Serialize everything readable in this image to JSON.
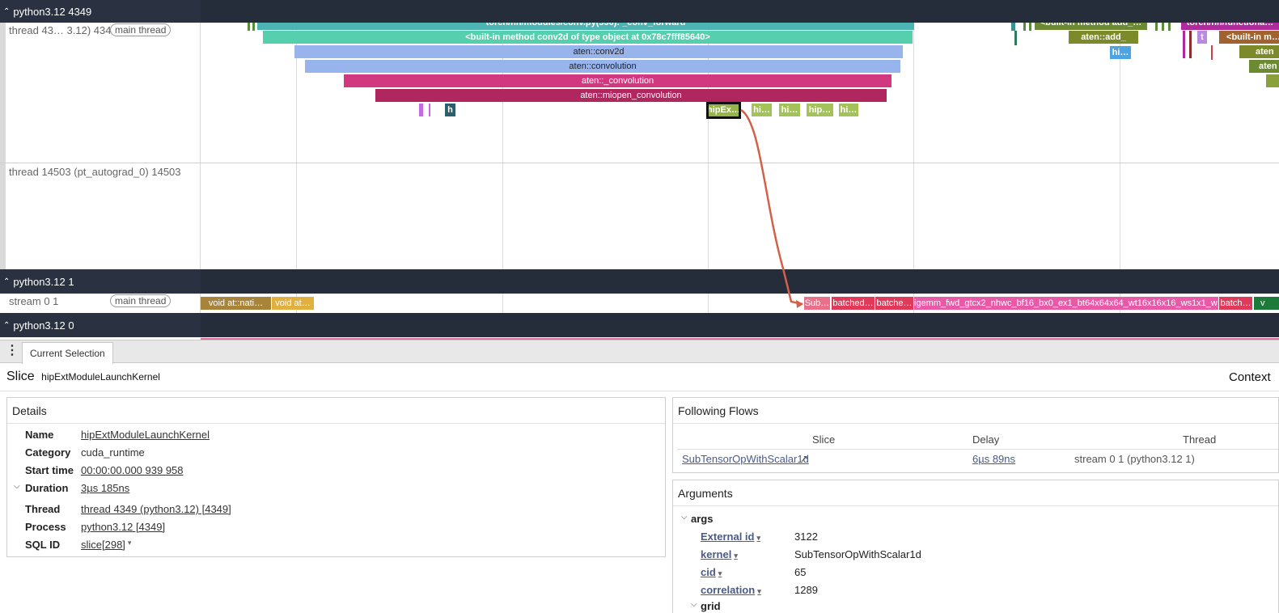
{
  "processes": {
    "p4349": {
      "title": "python3.12 4349"
    },
    "p1": {
      "title": "python3.12 1"
    },
    "p0": {
      "title": "python3.12 0"
    }
  },
  "tracks": {
    "main_thread": {
      "name": "thread 43…  3.12) 4349",
      "tag": "main thread"
    },
    "autograd": {
      "name": "thread 14503 (pt_autograd_0) 14503"
    },
    "stream": {
      "name": "stream 0 1",
      "tag": "main thread"
    }
  },
  "slices": {
    "conv_forward": "torch/nn/modules/conv.py(536): _conv_forward",
    "builtin_conv2d": "<built-in method conv2d of type object at 0x78c7fff85640>",
    "aten_conv2d": "aten::conv2d",
    "aten_convolution": "aten::convolution",
    "aten_underscore_convolution": "aten::_convolution",
    "aten_miopen": "aten::miopen_convolution",
    "h": "h",
    "hipext": "hipEx…",
    "hi1": "hi…",
    "hi2": "hi…",
    "hip3": "hip…",
    "hi4": "hi…",
    "builtin_add": "<built-in method add_…",
    "aten_add": "aten::add_",
    "hi_right": "hi…",
    "torch_functional": "torch/nn/functiona…",
    "t": "t",
    "builtin_right": "<built-in m…",
    "ater1": "aten",
    "ater2": "aten",
    "void1": "void at::nati…",
    "void2": "void at…",
    "sub": "Sub…",
    "batched1": "batched…",
    "batched2": "batche…",
    "igemm": "igemm_fwd_gtcx2_nhwc_bf16_bx0_ex1_bt64x64x64_wt16x16x16_ws1x1_w…",
    "batch3": "batch…",
    "v": "v"
  },
  "panel": {
    "tab": "Current Selection",
    "slice_label": "Slice",
    "slice_name": "hipExtModuleLaunchKernel",
    "context": "Context"
  },
  "details": {
    "title": "Details",
    "name_k": "Name",
    "name_v": "hipExtModuleLaunchKernel",
    "category_k": "Category",
    "category_v": "cuda_runtime",
    "start_k": "Start time",
    "start_v": "00:00:00.000 939 958",
    "duration_k": "Duration",
    "duration_v": "3µs 185ns",
    "thread_k": "Thread",
    "thread_v": "thread 4349 (python3.12) [4349]",
    "process_k": "Process",
    "process_v": "python3.12 [4349]",
    "sqlid_k": "SQL ID",
    "sqlid_v": "slice[298]"
  },
  "flows": {
    "title": "Following Flows",
    "col_slice": "Slice",
    "col_delay": "Delay",
    "col_thread": "Thread",
    "row_slice": "SubTensorOpWithScalar1d",
    "row_delay": "6µs 89ns",
    "row_thread": "stream 0 1 (python3.12 1)"
  },
  "arguments": {
    "title": "Arguments",
    "group": "args",
    "rows": [
      {
        "k": "External id",
        "v": "3122"
      },
      {
        "k": "kernel",
        "v": "SubTensorOpWithScalar1d"
      },
      {
        "k": "cid",
        "v": "65"
      },
      {
        "k": "correlation",
        "v": "1289"
      }
    ],
    "group2": "grid"
  }
}
